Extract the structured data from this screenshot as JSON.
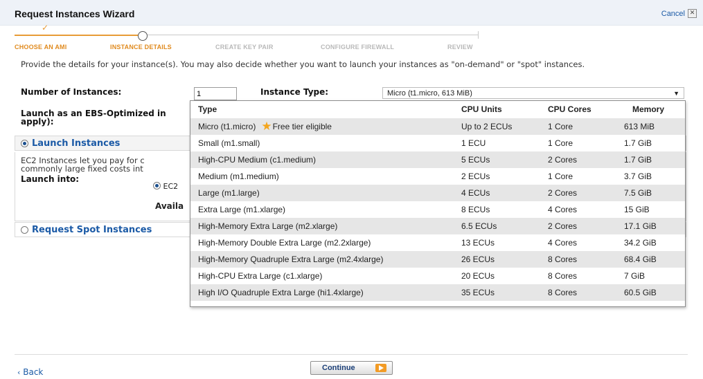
{
  "wizard": {
    "title": "Request Instances Wizard",
    "cancel_label": "Cancel",
    "close_glyph": "✕"
  },
  "steps": [
    {
      "label": "CHOOSE AN AMI",
      "state": "done"
    },
    {
      "label": "INSTANCE DETAILS",
      "state": "active"
    },
    {
      "label": "CREATE KEY PAIR",
      "state": "future"
    },
    {
      "label": "CONFIGURE FIREWALL",
      "state": "future"
    },
    {
      "label": "REVIEW",
      "state": "future"
    }
  ],
  "step_check_glyph": "✓",
  "intro": "Provide the details for your instance(s). You may also decide whether you want to launch your instances as \"on-demand\" or \"spot\" instances.",
  "form": {
    "num_instances_label": "Number of Instances:",
    "num_instances_value": "1",
    "instance_type_label": "Instance Type:",
    "instance_type_value": "Micro (t1.micro, 613 MiB)",
    "ebs_label_1": "Launch as an EBS-Optimized in",
    "ebs_label_2": "apply):"
  },
  "launch": {
    "title": "Launch Instances",
    "body_1": "EC2 Instances let you pay for c",
    "body_2": "commonly large fixed costs int",
    "launch_into": "Launch into:",
    "ec2_option": "EC2",
    "avail": "Availa"
  },
  "spot": {
    "title": "Request Spot Instances"
  },
  "dropdown": {
    "headers": {
      "type": "Type",
      "cpu_units": "CPU Units",
      "cpu_cores": "CPU Cores",
      "memory": "Memory"
    },
    "rows": [
      {
        "type": "Micro (t1.micro)",
        "badge": "Free tier eligible",
        "cpu_units": "Up to 2 ECUs",
        "cpu_cores": "1 Core",
        "memory": "613 MiB"
      },
      {
        "type": "Small (m1.small)",
        "cpu_units": "1 ECU",
        "cpu_cores": "1 Core",
        "memory": "1.7 GiB"
      },
      {
        "type": "High-CPU Medium (c1.medium)",
        "cpu_units": "5 ECUs",
        "cpu_cores": "2 Cores",
        "memory": "1.7 GiB"
      },
      {
        "type": "Medium (m1.medium)",
        "cpu_units": "2 ECUs",
        "cpu_cores": "1 Core",
        "memory": "3.7 GiB"
      },
      {
        "type": "Large (m1.large)",
        "cpu_units": "4 ECUs",
        "cpu_cores": "2 Cores",
        "memory": "7.5 GiB"
      },
      {
        "type": "Extra Large (m1.xlarge)",
        "cpu_units": "8 ECUs",
        "cpu_cores": "4 Cores",
        "memory": "15 GiB"
      },
      {
        "type": "High-Memory Extra Large (m2.xlarge)",
        "cpu_units": "6.5 ECUs",
        "cpu_cores": "2 Cores",
        "memory": "17.1 GiB"
      },
      {
        "type": "High-Memory Double Extra Large (m2.2xlarge)",
        "cpu_units": "13 ECUs",
        "cpu_cores": "4 Cores",
        "memory": "34.2 GiB"
      },
      {
        "type": "High-Memory Quadruple Extra Large (m2.4xlarge)",
        "cpu_units": "26 ECUs",
        "cpu_cores": "8 Cores",
        "memory": "68.4 GiB"
      },
      {
        "type": "High-CPU Extra Large (c1.xlarge)",
        "cpu_units": "20 ECUs",
        "cpu_cores": "8 Cores",
        "memory": "7 GiB"
      },
      {
        "type": "High I/O Quadruple Extra Large (hi1.4xlarge)",
        "cpu_units": "35 ECUs",
        "cpu_cores": "8 Cores",
        "memory": "60.5 GiB"
      }
    ]
  },
  "footer": {
    "back_label": "Back",
    "back_glyph": "‹",
    "continue_label": "Continue"
  },
  "colors": {
    "accent": "#e08a1e",
    "link": "#1a5aa6",
    "header_bg": "#eef2f8"
  },
  "icons": {
    "star": "star-icon",
    "close": "close-icon",
    "arrow": "arrow-right-icon"
  }
}
